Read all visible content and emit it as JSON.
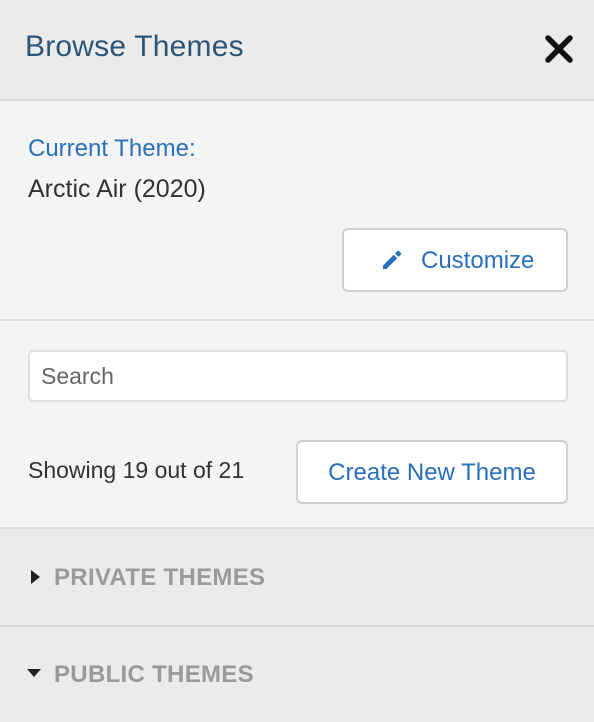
{
  "header": {
    "title": "Browse Themes",
    "close_icon": "close-x-icon"
  },
  "current_theme": {
    "label": "Current Theme:",
    "name": "Arctic Air (2020)",
    "customize_label": "Customize",
    "customize_icon": "pencil-icon"
  },
  "search": {
    "placeholder": "Search",
    "value": ""
  },
  "results": {
    "showing_text": "Showing 19 out of 21",
    "create_label": "Create New Theme"
  },
  "sections": {
    "private": {
      "title": "PRIVATE THEMES",
      "expanded": false,
      "caret_icon": "caret-right-icon"
    },
    "public": {
      "title": "PUBLIC THEMES",
      "expanded": true,
      "caret_icon": "caret-down-icon"
    }
  },
  "colors": {
    "accent": "#2a6fba",
    "title": "#2d5577",
    "section_title": "#9a9a9a"
  }
}
